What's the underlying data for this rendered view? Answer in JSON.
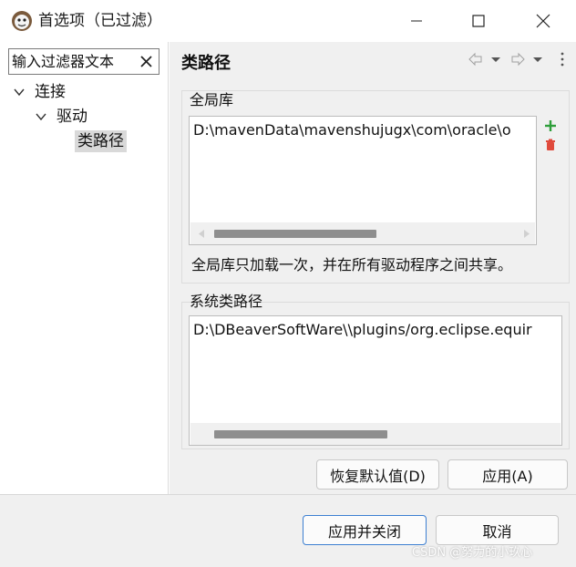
{
  "window": {
    "title": "首选项（已过滤）"
  },
  "filter": {
    "value": "输入过滤器文本"
  },
  "tree": {
    "items": [
      {
        "label": "连接",
        "level": 0,
        "expanded": true
      },
      {
        "label": "驱动",
        "level": 1,
        "expanded": true
      },
      {
        "label": "类路径",
        "level": 2,
        "selected": true
      }
    ]
  },
  "page": {
    "title": "类路径"
  },
  "global_library": {
    "label": "全局库",
    "entries": [
      "D:\\mavenData\\mavenshujugx\\com\\oracle\\o"
    ],
    "note": "全局库只加载一次，并在所有驱动程序之间共享。",
    "scroll_position": 0.1
  },
  "system_classpath": {
    "label": "系统类路径",
    "entries": [
      "D:\\DBeaverSoftWare\\\\plugins/org.eclipse.equir"
    ],
    "scroll_position": 0.1
  },
  "buttons": {
    "restore_defaults": "恢复默认值(D)",
    "apply": "应用(A)",
    "apply_and_close": "应用并关闭",
    "cancel": "取消"
  },
  "watermark": "CSDN @努力的小玖心",
  "colors": {
    "add_icon": "#2e9e3a",
    "delete_icon": "#e04a3c",
    "primary_border": "#3c7fd1",
    "selection": "#d9d9d9"
  }
}
